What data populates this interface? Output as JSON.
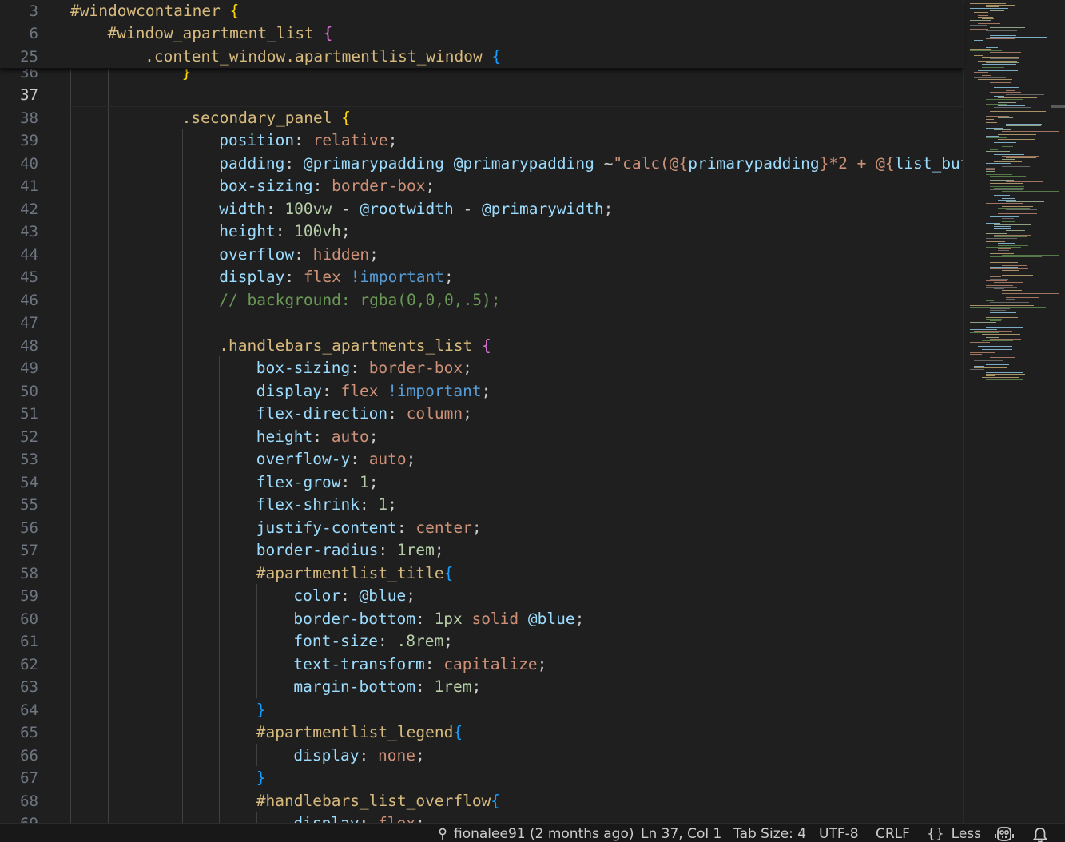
{
  "sticky_lines": [
    {
      "n": "3",
      "tokens": [
        [
          "sel-id",
          "#windowcontainer"
        ],
        [
          "punc",
          " "
        ],
        [
          "b1",
          "{"
        ]
      ]
    },
    {
      "n": "6",
      "tokens": [
        [
          "sel-id",
          "#window_apartment_list"
        ],
        [
          "punc",
          " "
        ],
        [
          "b2",
          "{"
        ]
      ]
    },
    {
      "n": "25",
      "tokens": [
        [
          "sel-class",
          ".content_window.apartmentlist_window"
        ],
        [
          "punc",
          " "
        ],
        [
          "b3",
          "{"
        ]
      ]
    }
  ],
  "lines": [
    {
      "n": "36",
      "tokens": [
        [
          "b1",
          "}"
        ]
      ]
    },
    {
      "n": "37",
      "tokens": []
    },
    {
      "n": "38",
      "tokens": [
        [
          "sel-class",
          ".secondary_panel"
        ],
        [
          "punc",
          " "
        ],
        [
          "b1",
          "{"
        ]
      ]
    },
    {
      "n": "39",
      "tokens": [
        [
          "prop",
          "position"
        ],
        [
          "punc",
          ": "
        ],
        [
          "val",
          "relative"
        ],
        [
          "punc",
          ";"
        ]
      ]
    },
    {
      "n": "40",
      "tokens": [
        [
          "prop",
          "padding"
        ],
        [
          "punc",
          ": "
        ],
        [
          "var",
          "@primarypadding"
        ],
        [
          "punc",
          " "
        ],
        [
          "var",
          "@primarypadding"
        ],
        [
          "punc",
          " ~"
        ],
        [
          "val",
          "\"calc(@{"
        ],
        [
          "var",
          "primarypadding"
        ],
        [
          "val",
          "}*2 + @{"
        ],
        [
          "var",
          "list_butt"
        ]
      ]
    },
    {
      "n": "41",
      "tokens": [
        [
          "prop",
          "box-sizing"
        ],
        [
          "punc",
          ": "
        ],
        [
          "val",
          "border-box"
        ],
        [
          "punc",
          ";"
        ]
      ]
    },
    {
      "n": "42",
      "tokens": [
        [
          "prop",
          "width"
        ],
        [
          "punc",
          ": "
        ],
        [
          "num",
          "100vw"
        ],
        [
          "punc",
          " - "
        ],
        [
          "var",
          "@rootwidth"
        ],
        [
          "punc",
          " - "
        ],
        [
          "var",
          "@primarywidth"
        ],
        [
          "punc",
          ";"
        ]
      ]
    },
    {
      "n": "43",
      "tokens": [
        [
          "prop",
          "height"
        ],
        [
          "punc",
          ": "
        ],
        [
          "num",
          "100vh"
        ],
        [
          "punc",
          ";"
        ]
      ]
    },
    {
      "n": "44",
      "tokens": [
        [
          "prop",
          "overflow"
        ],
        [
          "punc",
          ": "
        ],
        [
          "val",
          "hidden"
        ],
        [
          "punc",
          ";"
        ]
      ]
    },
    {
      "n": "45",
      "tokens": [
        [
          "prop",
          "display"
        ],
        [
          "punc",
          ": "
        ],
        [
          "val",
          "flex"
        ],
        [
          "punc",
          " "
        ],
        [
          "kw",
          "!important"
        ],
        [
          "punc",
          ";"
        ]
      ]
    },
    {
      "n": "46",
      "tokens": [
        [
          "cm",
          "// background: rgba(0,0,0,.5);"
        ]
      ]
    },
    {
      "n": "47",
      "tokens": []
    },
    {
      "n": "48",
      "tokens": [
        [
          "sel-class",
          ".handlebars_apartments_list"
        ],
        [
          "punc",
          " "
        ],
        [
          "b2",
          "{"
        ]
      ]
    },
    {
      "n": "49",
      "tokens": [
        [
          "prop",
          "box-sizing"
        ],
        [
          "punc",
          ": "
        ],
        [
          "val",
          "border-box"
        ],
        [
          "punc",
          ";"
        ]
      ]
    },
    {
      "n": "50",
      "tokens": [
        [
          "prop",
          "display"
        ],
        [
          "punc",
          ": "
        ],
        [
          "val",
          "flex"
        ],
        [
          "punc",
          " "
        ],
        [
          "kw",
          "!important"
        ],
        [
          "punc",
          ";"
        ]
      ]
    },
    {
      "n": "51",
      "tokens": [
        [
          "prop",
          "flex-direction"
        ],
        [
          "punc",
          ": "
        ],
        [
          "val",
          "column"
        ],
        [
          "punc",
          ";"
        ]
      ]
    },
    {
      "n": "52",
      "tokens": [
        [
          "prop",
          "height"
        ],
        [
          "punc",
          ": "
        ],
        [
          "val",
          "auto"
        ],
        [
          "punc",
          ";"
        ]
      ]
    },
    {
      "n": "53",
      "tokens": [
        [
          "prop",
          "overflow-y"
        ],
        [
          "punc",
          ": "
        ],
        [
          "val",
          "auto"
        ],
        [
          "punc",
          ";"
        ]
      ]
    },
    {
      "n": "54",
      "tokens": [
        [
          "prop",
          "flex-grow"
        ],
        [
          "punc",
          ": "
        ],
        [
          "num",
          "1"
        ],
        [
          "punc",
          ";"
        ]
      ]
    },
    {
      "n": "55",
      "tokens": [
        [
          "prop",
          "flex-shrink"
        ],
        [
          "punc",
          ": "
        ],
        [
          "num",
          "1"
        ],
        [
          "punc",
          ";"
        ]
      ]
    },
    {
      "n": "56",
      "tokens": [
        [
          "prop",
          "justify-content"
        ],
        [
          "punc",
          ": "
        ],
        [
          "val",
          "center"
        ],
        [
          "punc",
          ";"
        ]
      ]
    },
    {
      "n": "57",
      "tokens": [
        [
          "prop",
          "border-radius"
        ],
        [
          "punc",
          ": "
        ],
        [
          "num",
          "1rem"
        ],
        [
          "punc",
          ";"
        ]
      ]
    },
    {
      "n": "58",
      "tokens": [
        [
          "sel-id",
          "#apartmentlist_title"
        ],
        [
          "b3",
          "{"
        ]
      ]
    },
    {
      "n": "59",
      "tokens": [
        [
          "prop",
          "color"
        ],
        [
          "punc",
          ": "
        ],
        [
          "var",
          "@blue"
        ],
        [
          "punc",
          ";"
        ]
      ]
    },
    {
      "n": "60",
      "tokens": [
        [
          "prop",
          "border-bottom"
        ],
        [
          "punc",
          ": "
        ],
        [
          "num",
          "1px"
        ],
        [
          "punc",
          " "
        ],
        [
          "val",
          "solid"
        ],
        [
          "punc",
          " "
        ],
        [
          "var",
          "@blue"
        ],
        [
          "punc",
          ";"
        ]
      ]
    },
    {
      "n": "61",
      "tokens": [
        [
          "prop",
          "font-size"
        ],
        [
          "punc",
          ": "
        ],
        [
          "num",
          ".8rem"
        ],
        [
          "punc",
          ";"
        ]
      ]
    },
    {
      "n": "62",
      "tokens": [
        [
          "prop",
          "text-transform"
        ],
        [
          "punc",
          ": "
        ],
        [
          "val",
          "capitalize"
        ],
        [
          "punc",
          ";"
        ]
      ]
    },
    {
      "n": "63",
      "tokens": [
        [
          "prop",
          "margin-bottom"
        ],
        [
          "punc",
          ": "
        ],
        [
          "num",
          "1rem"
        ],
        [
          "punc",
          ";"
        ]
      ]
    },
    {
      "n": "64",
      "tokens": [
        [
          "b3",
          "}"
        ]
      ]
    },
    {
      "n": "65",
      "tokens": [
        [
          "sel-id",
          "#apartmentlist_legend"
        ],
        [
          "b3",
          "{"
        ]
      ]
    },
    {
      "n": "66",
      "tokens": [
        [
          "prop",
          "display"
        ],
        [
          "punc",
          ": "
        ],
        [
          "val",
          "none"
        ],
        [
          "punc",
          ";"
        ]
      ]
    },
    {
      "n": "67",
      "tokens": [
        [
          "b3",
          "}"
        ]
      ]
    },
    {
      "n": "68",
      "tokens": [
        [
          "sel-id",
          "#handlebars_list_overflow"
        ],
        [
          "b3",
          "{"
        ]
      ]
    },
    {
      "n": "69",
      "tokens": [
        [
          "prop",
          "display"
        ],
        [
          "punc",
          ": "
        ],
        [
          "val",
          "flex"
        ],
        [
          "punc",
          ";"
        ]
      ]
    }
  ],
  "active_line": "37",
  "status": {
    "blame": "fionalee91 (2 months ago)",
    "cursor": "Ln 37, Col 1",
    "tab_size": "Tab Size: 4",
    "encoding": "UTF-8",
    "eol": "CRLF",
    "language_icon": "{}",
    "language": "Less",
    "copilot_icon": "copilot-icon",
    "bell_icon": "bell-icon"
  },
  "colors": {
    "background": "#1f1f1f",
    "statusbar": "#181818",
    "selector": "#d7ba7d",
    "property": "#9cdcfe",
    "value": "#ce9178",
    "number": "#b5cea8",
    "keyword": "#569cd6",
    "comment": "#6a9955",
    "bracket_1": "#ffd700",
    "bracket_2": "#da70d6",
    "bracket_3": "#179fff"
  }
}
